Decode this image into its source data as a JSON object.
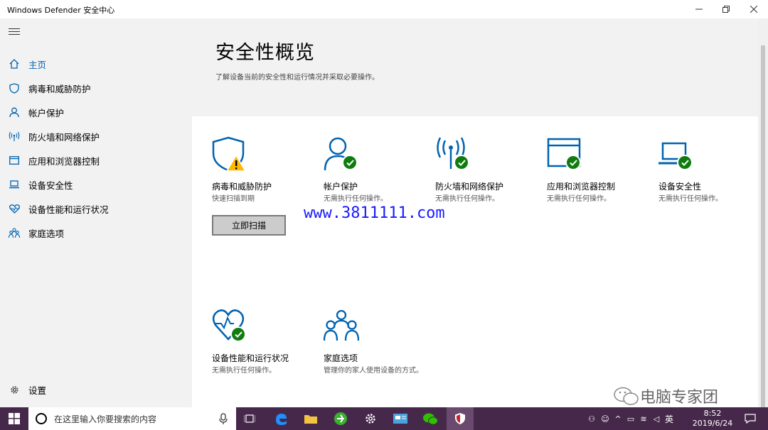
{
  "window": {
    "title": "Windows Defender 安全中心",
    "controls": [
      "minimize",
      "restore",
      "close"
    ]
  },
  "sidebar": {
    "items": [
      {
        "label": "主页",
        "icon": "home-icon",
        "active": true
      },
      {
        "label": "病毒和威胁防护",
        "icon": "shield-icon"
      },
      {
        "label": "帐户保护",
        "icon": "person-icon"
      },
      {
        "label": "防火墙和网络保护",
        "icon": "wifi-antenna-icon"
      },
      {
        "label": "应用和浏览器控制",
        "icon": "app-window-icon"
      },
      {
        "label": "设备安全性",
        "icon": "laptop-icon"
      },
      {
        "label": "设备性能和运行状况",
        "icon": "heart-icon"
      },
      {
        "label": "家庭选项",
        "icon": "family-icon"
      }
    ],
    "settings_label": "设置"
  },
  "main": {
    "title": "安全性概览",
    "subtitle": "了解设备当前的安全性和运行情况并采取必要操作。",
    "cards": [
      {
        "title": "病毒和威胁防护",
        "desc": "快速扫描到期",
        "status": "warning",
        "button": "立即扫描"
      },
      {
        "title": "帐户保护",
        "desc": "无需执行任何操作。",
        "status": "ok"
      },
      {
        "title": "防火墙和网络保护",
        "desc": "无需执行任何操作。",
        "status": "ok"
      },
      {
        "title": "应用和浏览器控制",
        "desc": "无需执行任何操作。",
        "status": "ok"
      },
      {
        "title": "设备安全性",
        "desc": "无需执行任何操作。",
        "status": "ok"
      },
      {
        "title": "设备性能和运行状况",
        "desc": "无需执行任何操作。",
        "status": "ok"
      },
      {
        "title": "家庭选项",
        "desc": "管理你的家人使用设备的方式。",
        "status": "none"
      }
    ]
  },
  "overlay": {
    "url": "www.3811111.com",
    "wechat_account": "电脑专家团"
  },
  "taskbar": {
    "search_placeholder": "在这里输入你要搜索的内容",
    "time": "8:52",
    "date": "2019/6/24",
    "ime": "英"
  },
  "colors": {
    "accent": "#0063b1",
    "ok": "#107c10",
    "warning": "#ffb900",
    "taskbar": "#46294a"
  }
}
